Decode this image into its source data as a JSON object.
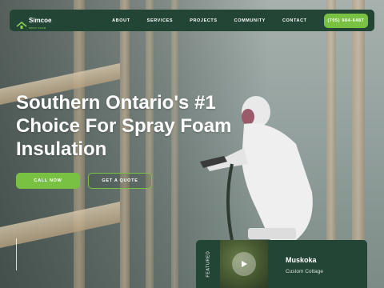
{
  "nav": {
    "logo_text": "Simcoe",
    "logo_sub": "SPRAY FOAM",
    "links": [
      "ABOUT",
      "SERVICES",
      "PROJECTS",
      "COMMUNITY",
      "CONTACT"
    ],
    "phone_label": "(705) 984-6487"
  },
  "hero": {
    "headline_line1": "Southern Ontario's #1",
    "headline_line2": "Choice For Spray Foam",
    "headline_line3": "Insulation",
    "call_label": "CALL NOW",
    "quote_label": "GET A QUOTE"
  },
  "featured": {
    "label": "FEATURED",
    "title": "Muskoka",
    "subtitle": "Custom Cottage"
  },
  "colors": {
    "brand_dark": "#234536",
    "accent_green": "#79c143"
  },
  "icons": [
    "house-roof-icon",
    "play-icon"
  ]
}
